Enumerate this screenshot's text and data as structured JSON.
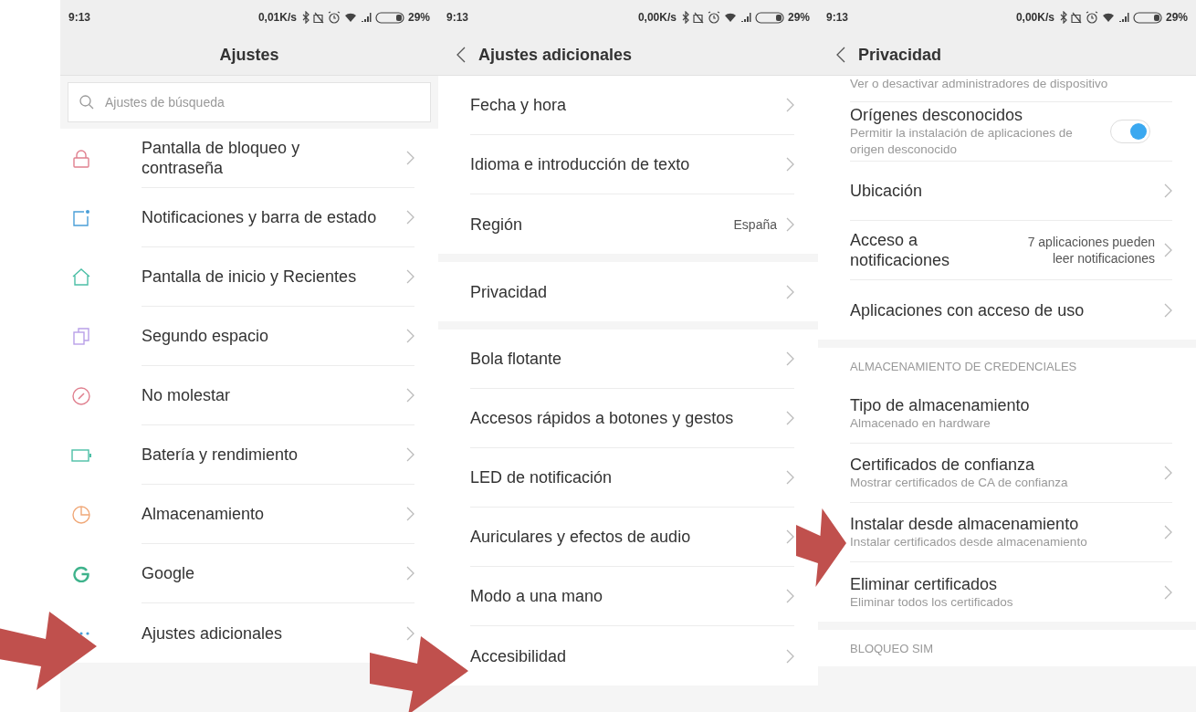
{
  "screens": [
    {
      "status_bar": {
        "time": "9:13",
        "speed": "0,01K/s",
        "battery": "29%"
      },
      "title": "Ajustes",
      "back": false,
      "search": {
        "placeholder": "Ajustes de búsqueda"
      },
      "groups": [
        {
          "items": [
            {
              "kind": "nav",
              "title": "Pantalla de bloqueo y contraseña",
              "chevron": true
            },
            {
              "kind": "nav",
              "title": "Notificaciones y barra de estado",
              "chevron": true
            },
            {
              "kind": "nav",
              "title": "Pantalla de inicio y Recientes",
              "chevron": true
            },
            {
              "kind": "nav",
              "title": "Segundo espacio",
              "chevron": true
            },
            {
              "kind": "nav",
              "title": "No molestar",
              "chevron": true
            },
            {
              "kind": "nav",
              "title": "Batería y rendimiento",
              "chevron": true
            },
            {
              "kind": "nav",
              "title": "Almacenamiento",
              "chevron": true
            },
            {
              "kind": "nav",
              "title": "Google",
              "chevron": true
            },
            {
              "kind": "nav",
              "title": "Ajustes adicionales",
              "chevron": true
            }
          ]
        }
      ]
    },
    {
      "status_bar": {
        "time": "9:13",
        "speed": "0,00K/s",
        "battery": "29%"
      },
      "title": "Ajustes adicionales",
      "back": true,
      "groups": [
        {
          "items": [
            {
              "kind": "nav",
              "title": "Fecha y hora",
              "chevron": true
            },
            {
              "kind": "nav",
              "title": "Idioma e introducción de texto",
              "chevron": true
            },
            {
              "kind": "nav",
              "title": "Región",
              "value": "España",
              "chevron": true
            }
          ]
        },
        {
          "items": [
            {
              "kind": "nav",
              "title": "Privacidad",
              "chevron": true
            }
          ]
        },
        {
          "items": [
            {
              "kind": "nav",
              "title": "Bola flotante",
              "chevron": true
            },
            {
              "kind": "nav",
              "title": "Accesos rápidos a botones y gestos",
              "chevron": true
            },
            {
              "kind": "nav",
              "title": "LED de notificación",
              "chevron": true
            },
            {
              "kind": "nav",
              "title": "Auriculares y efectos de audio",
              "chevron": true
            },
            {
              "kind": "nav",
              "title": "Modo a una mano",
              "chevron": true
            },
            {
              "kind": "nav",
              "title": "Accesibilidad",
              "chevron": true
            }
          ]
        }
      ]
    },
    {
      "status_bar": {
        "time": "9:13",
        "speed": "0,00K/s",
        "battery": "29%"
      },
      "title": "Privacidad",
      "back": true,
      "groups": [
        {
          "items": [
            {
              "kind": "partial",
              "subtitle": "Ver o desactivar administradores de dispositivo"
            },
            {
              "kind": "toggle",
              "title": "Orígenes desconocidos",
              "subtitle": "Permitir la instalación de aplicaciones de origen desconocido",
              "on": true
            },
            {
              "kind": "nav",
              "title": "Ubicación",
              "chevron": true
            },
            {
              "kind": "nav",
              "title": "Acceso a notificaciones",
              "value": "7 aplicaciones pueden leer notificaciones",
              "chevron": true
            },
            {
              "kind": "nav",
              "title": "Aplicaciones con acceso de uso",
              "chevron": true
            }
          ]
        },
        {
          "header": "ALMACENAMIENTO DE CREDENCIALES",
          "items": [
            {
              "kind": "nav",
              "title": "Tipo de almacenamiento",
              "subtitle": "Almacenado en hardware",
              "chevron": false
            },
            {
              "kind": "nav",
              "title": "Certificados de confianza",
              "subtitle": "Mostrar certificados de CA de confianza",
              "chevron": true
            },
            {
              "kind": "nav",
              "title": "Instalar desde almacenamiento",
              "subtitle": "Instalar certificados desde almacenamiento",
              "chevron": true
            },
            {
              "kind": "nav",
              "title": "Eliminar certificados",
              "subtitle": "Eliminar todos los certificados",
              "chevron": true
            }
          ]
        },
        {
          "header": "BLOQUEO SIM"
        }
      ]
    }
  ],
  "annotations": [
    {
      "kind": "arrow"
    },
    {
      "kind": "arrow"
    },
    {
      "kind": "arrow"
    }
  ]
}
